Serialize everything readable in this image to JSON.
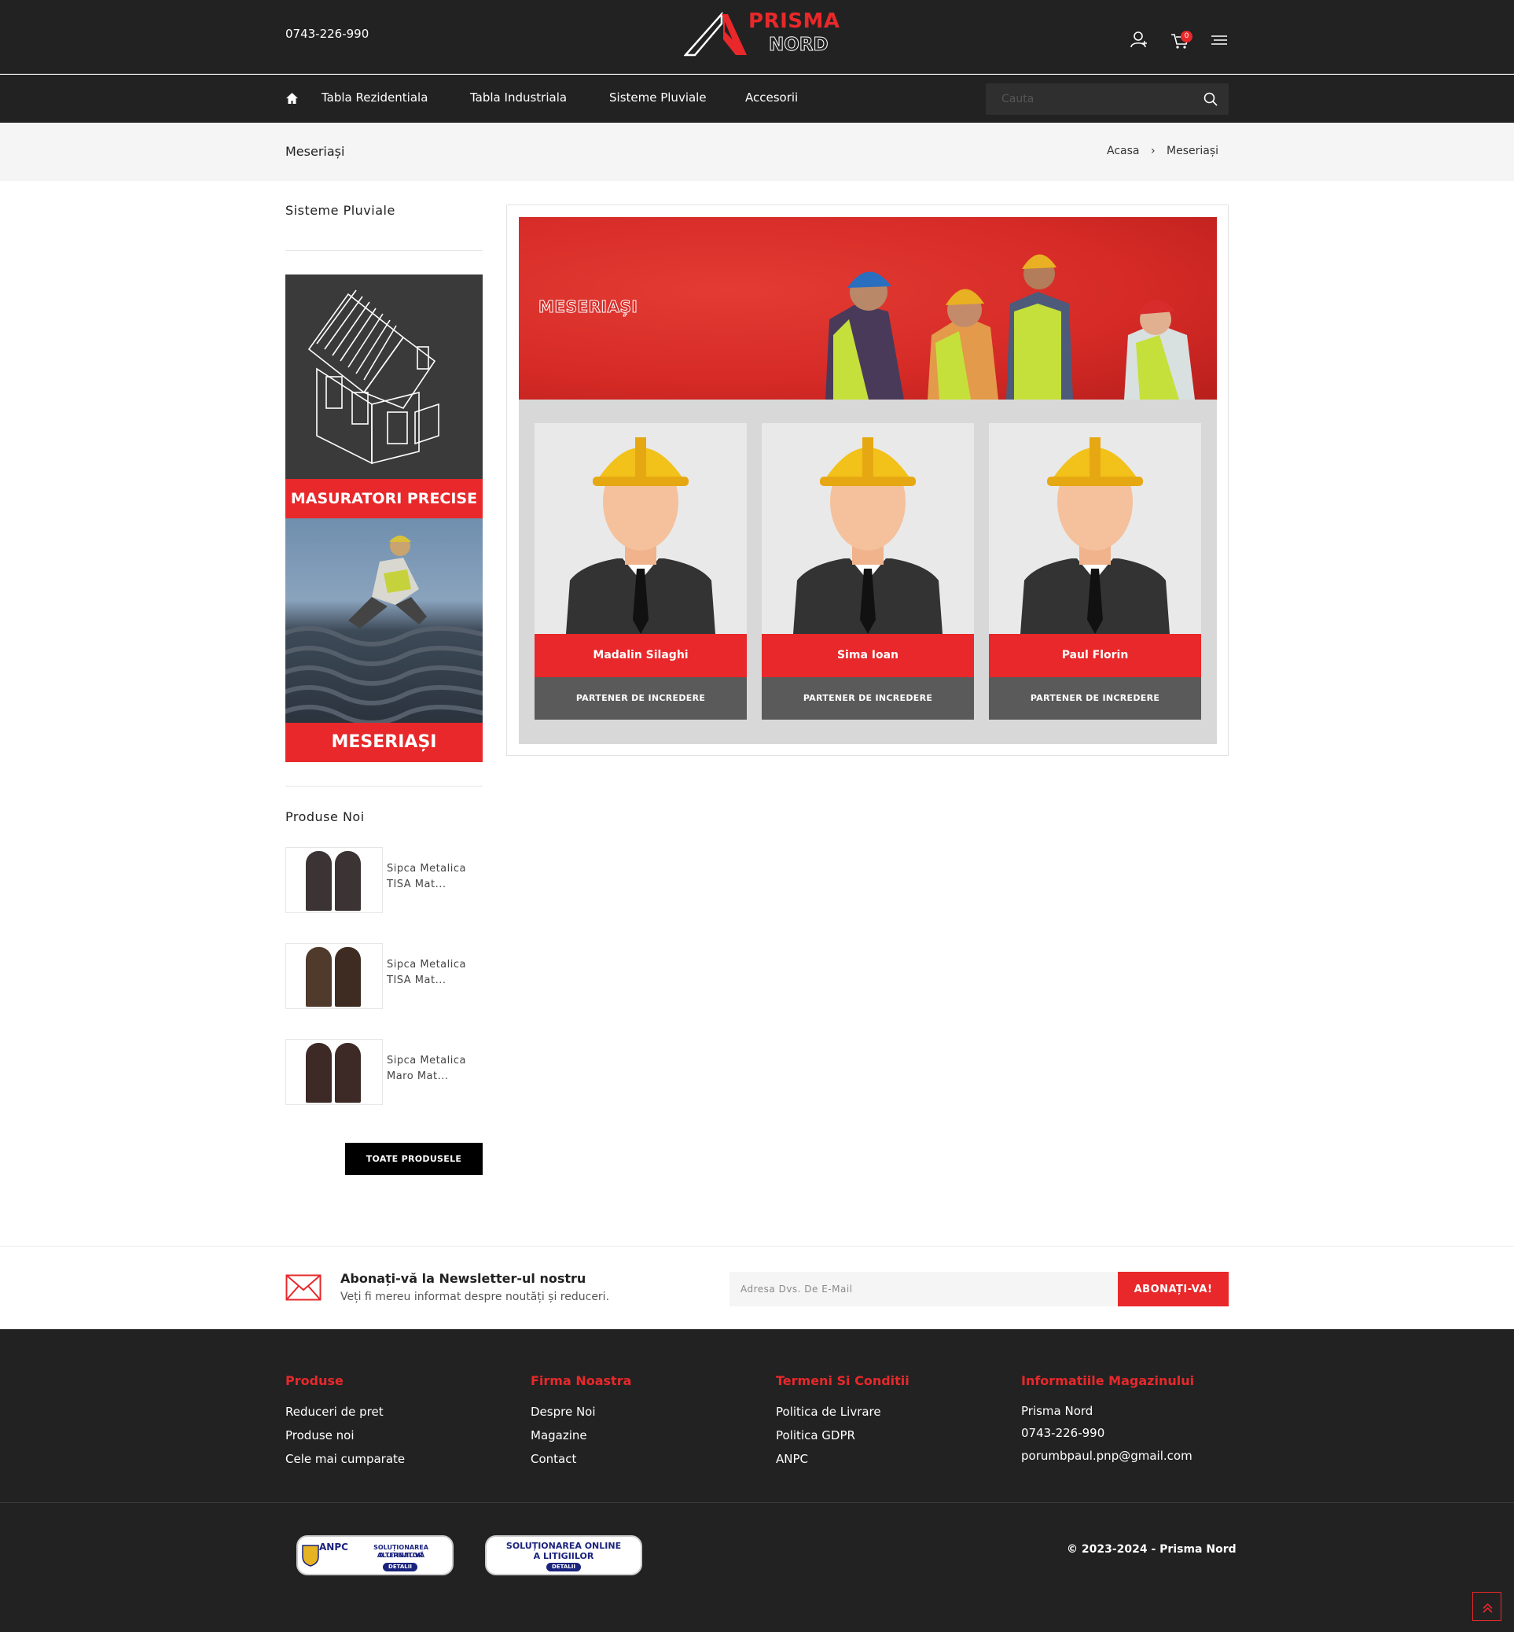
{
  "header": {
    "phone": "0743-226-990",
    "logo_line1": "PRISMA",
    "logo_line2": "NORD",
    "cart_count": "0"
  },
  "nav": {
    "items": [
      "Tabla Rezidentiala",
      "Tabla Industriala",
      "Sisteme Pluviale",
      "Accesorii"
    ],
    "search_placeholder": "Cauta"
  },
  "page": {
    "title": "Meseriași",
    "breadcrumb": [
      "Acasa",
      "Meseriași"
    ]
  },
  "sidebar": {
    "category_title": "Sisteme Pluviale",
    "banner_label1": "MASURATORI PRECISE",
    "banner_label2": "MESERIAȘI",
    "new_products_title": "Produse Noi",
    "products": [
      {
        "name": "Sipca Metalica TISA Mat...",
        "color": "#3c3434"
      },
      {
        "name": "Sipca Metalica TISA Mat...",
        "color": "#4f3a2c"
      },
      {
        "name": "Sipca Metalica Maro Mat...",
        "color": "#3d2a26"
      }
    ],
    "all_products_button": "TOATE PRODUSELE"
  },
  "main": {
    "hero_title": "MESERIAȘI",
    "cards": [
      {
        "name": "Madalin Silaghi",
        "role": "PARTENER DE INCREDERE"
      },
      {
        "name": "Sima Ioan",
        "role": "PARTENER DE INCREDERE"
      },
      {
        "name": "Paul Florin",
        "role": "PARTENER DE INCREDERE"
      }
    ]
  },
  "newsletter": {
    "title": "Abonați-vă la Newsletter-ul nostru",
    "subtitle": "Veți fi mereu informat despre noutăți și reduceri.",
    "email_placeholder": "Adresa Dvs. De E-Mail",
    "button": "ABONAȚI-VA!"
  },
  "footer": {
    "columns": [
      {
        "title": "Produse",
        "links": [
          "Reduceri de pret",
          "Produse noi",
          "Cele mai cumparate"
        ]
      },
      {
        "title": "Firma Noastra",
        "links": [
          "Despre Noi",
          "Magazine",
          "Contact"
        ]
      },
      {
        "title": "Termeni Si Conditii",
        "links": [
          "Politica de Livrare",
          "Politica GDPR",
          "ANPC"
        ]
      },
      {
        "title": "Informatiile Magazinului",
        "links": [
          "Prisma Nord",
          "0743-226-990",
          "porumbpaul.pnp@gmail.com"
        ]
      }
    ],
    "badge1_line1": "SOLUȚIONAREA ALTERNATIVĂ",
    "badge1_line2": "A LITIGIILOR",
    "badge1_logo": "ANPC",
    "badge2_line1": "SOLUȚIONAREA ONLINE",
    "badge2_line2": "A LITIGIILOR",
    "badge_detail": "DETALII",
    "copyright": "© 2023-2024 - Prisma Nord"
  },
  "colors": {
    "accent": "#e8282a",
    "dark": "#222222"
  }
}
